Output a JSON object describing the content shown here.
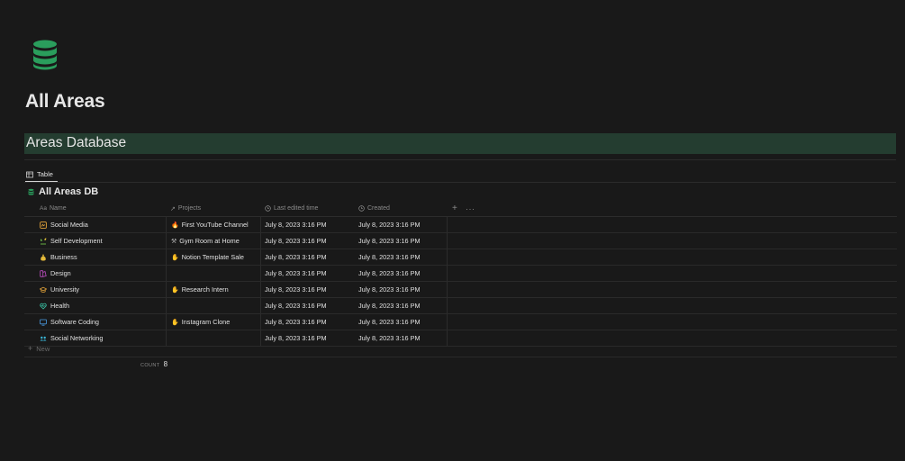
{
  "page": {
    "icon": "database-icon",
    "title": "All Areas"
  },
  "banner": {
    "text": "Areas Database",
    "color": "#243d30"
  },
  "views": {
    "active_tab": {
      "icon": "table-icon",
      "label": "Table"
    }
  },
  "database": {
    "icon": "database-icon",
    "title": "All Areas DB",
    "columns": {
      "name": {
        "icon": "text-icon",
        "label": "Name"
      },
      "projects": {
        "icon": "relation-arrow-icon",
        "label": "Projects"
      },
      "last_edited": {
        "icon": "clock-icon",
        "label": "Last edited time"
      },
      "created": {
        "icon": "clock-icon",
        "label": "Created"
      },
      "add": "+",
      "more": "···"
    },
    "rows": [
      {
        "icon": "social-media-icon",
        "name": "Social Media",
        "project_icon": "fire-icon",
        "project": "First YouTube Channel",
        "last_edited": "July 8, 2023 3:16 PM",
        "created": "July 8, 2023 3:16 PM"
      },
      {
        "icon": "plant-icon",
        "name": "Self Development",
        "project_icon": "dumbbell-icon",
        "project": "Gym Room at Home",
        "last_edited": "July 8, 2023 3:16 PM",
        "created": "July 8, 2023 3:16 PM"
      },
      {
        "icon": "money-bag-icon",
        "name": "Business",
        "project_icon": "hands-icon",
        "project": "Notion Template Sale",
        "last_edited": "July 8, 2023 3:16 PM",
        "created": "July 8, 2023 3:16 PM"
      },
      {
        "icon": "palette-icon",
        "name": "Design",
        "project_icon": "",
        "project": "",
        "last_edited": "July 8, 2023 3:16 PM",
        "created": "July 8, 2023 3:16 PM"
      },
      {
        "icon": "graduation-cap-icon",
        "name": "University",
        "project_icon": "hands-icon",
        "project": "Research Intern",
        "last_edited": "July 8, 2023 3:16 PM",
        "created": "July 8, 2023 3:16 PM"
      },
      {
        "icon": "heart-pulse-icon",
        "name": "Health",
        "project_icon": "",
        "project": "",
        "last_edited": "July 8, 2023 3:16 PM",
        "created": "July 8, 2023 3:16 PM"
      },
      {
        "icon": "monitor-icon",
        "name": "Software Coding",
        "project_icon": "hands-icon",
        "project": "Instagram Clone",
        "last_edited": "July 8, 2023 3:16 PM",
        "created": "July 8, 2023 3:16 PM"
      },
      {
        "icon": "people-icon",
        "name": "Social Networking",
        "project_icon": "",
        "project": "",
        "last_edited": "July 8, 2023 3:16 PM",
        "created": "July 8, 2023 3:16 PM"
      }
    ],
    "new_label": "New",
    "count_label": "COUNT",
    "count_value": "8"
  },
  "colors": {
    "background": "#191919",
    "accent_green": "#2a9d5c",
    "text": "#e0e0e0",
    "muted": "#8a8a8a"
  }
}
